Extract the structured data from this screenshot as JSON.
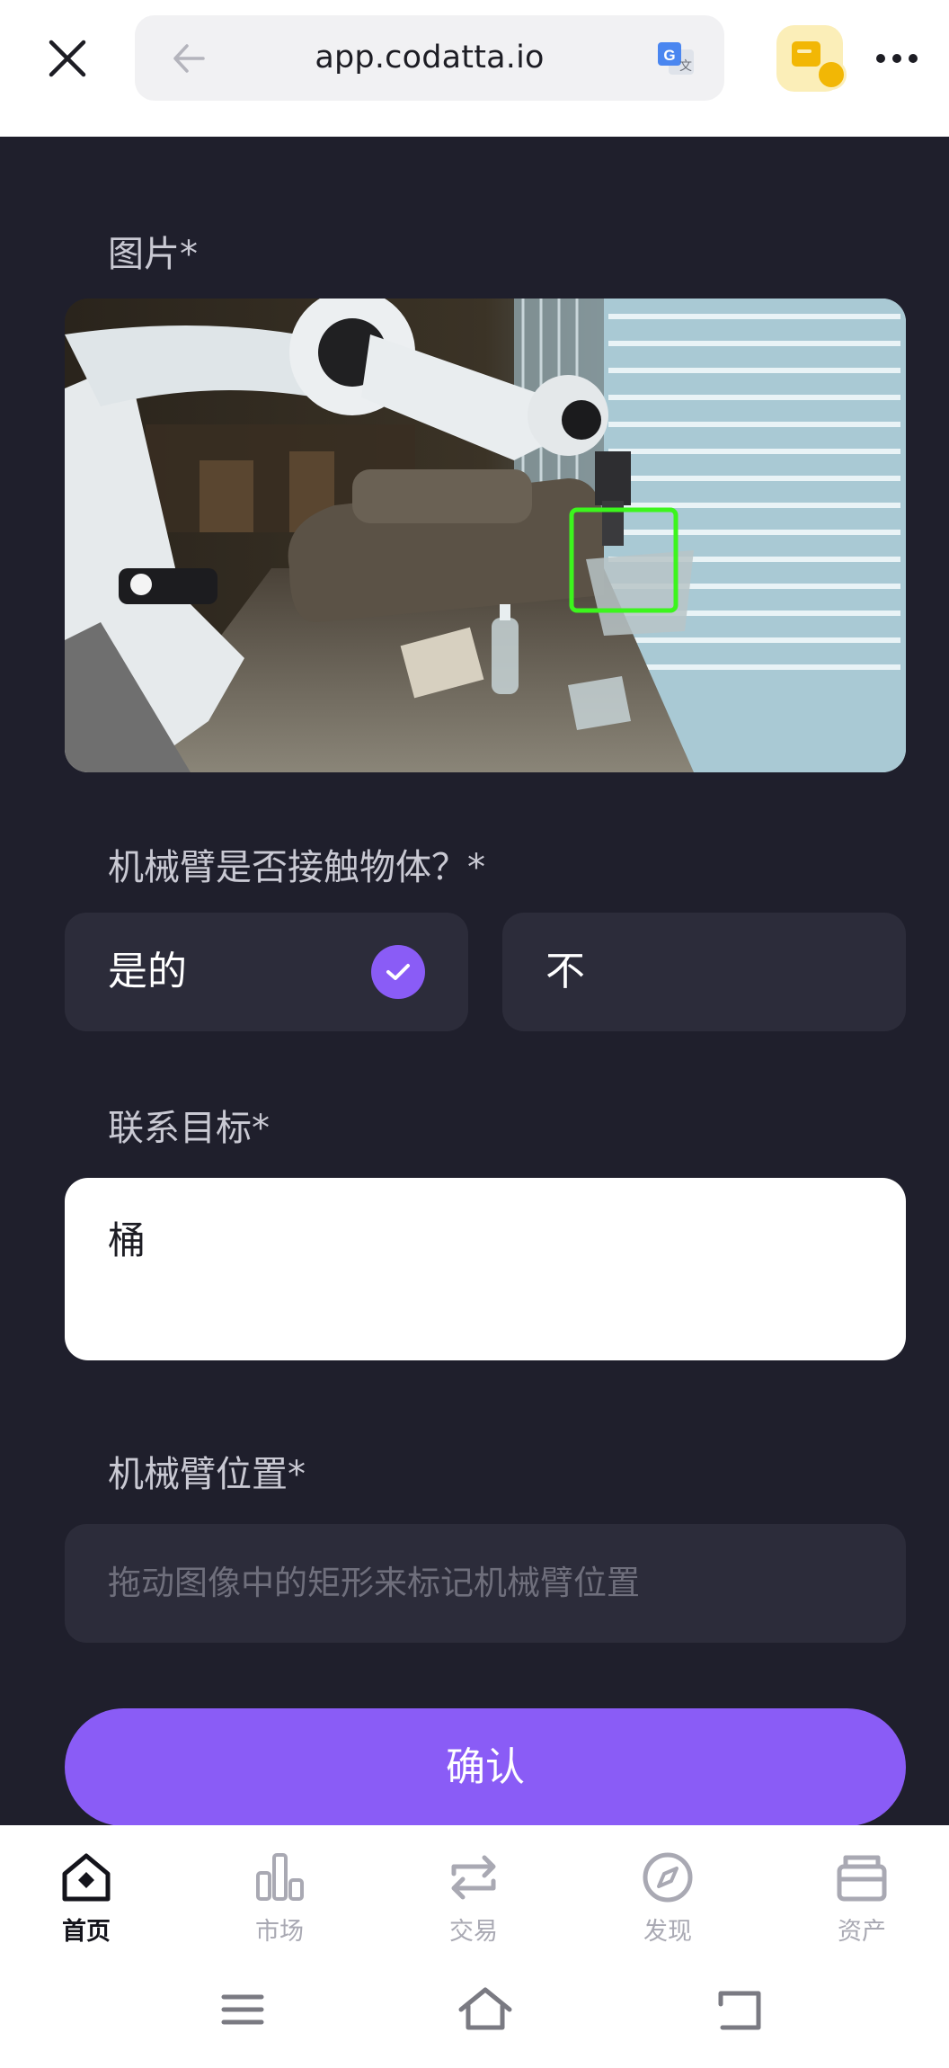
{
  "browser": {
    "url": "app.codatta.io"
  },
  "form": {
    "image_label": "图片*",
    "contact_question": "机械臂是否接触物体？*",
    "options": [
      {
        "label": "是的",
        "selected": true
      },
      {
        "label": "不",
        "selected": false
      }
    ],
    "target_label": "联系目标*",
    "target_value": "桶",
    "position_label": "机械臂位置*",
    "position_placeholder": "拖动图像中的矩形来标记机械臂位置",
    "confirm_label": "确认"
  },
  "bottom_nav": {
    "items": [
      {
        "label": "首页",
        "icon": "home-icon",
        "active": true
      },
      {
        "label": "市场",
        "icon": "market-icon",
        "active": false
      },
      {
        "label": "交易",
        "icon": "trade-icon",
        "active": false
      },
      {
        "label": "发现",
        "icon": "discover-icon",
        "active": false
      },
      {
        "label": "资产",
        "icon": "assets-icon",
        "active": false
      }
    ]
  },
  "colors": {
    "accent": "#8a5cf6",
    "background": "#1f1f2c",
    "card": "#2c2c3a",
    "annotation_box": "#3cf51d"
  }
}
